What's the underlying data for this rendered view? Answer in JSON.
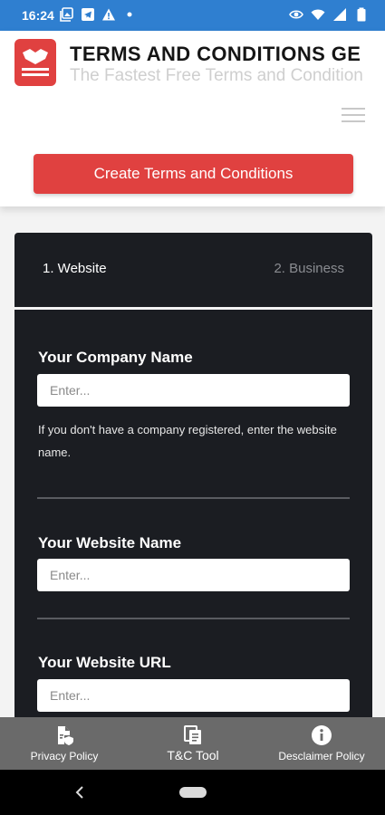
{
  "status_bar": {
    "time": "16:24",
    "left_icons": [
      "gallery-icon",
      "telegram-icon",
      "warning-icon",
      "dot-icon"
    ],
    "right_icons": [
      "eye-icon",
      "wifi-icon",
      "signal-icon",
      "battery-icon"
    ]
  },
  "header": {
    "title": "TERMS AND CONDITIONS GE",
    "subtitle": "The Fastest Free Terms and Condition",
    "cta_label": "Create Terms and Conditions",
    "accent_color": "#e04140"
  },
  "steps": {
    "active": "1. Website",
    "inactive": "2. Business"
  },
  "form": {
    "company": {
      "label": "Your Company Name",
      "placeholder": "Enter...",
      "value": "",
      "help": "If you don't have a company registered, enter the website name."
    },
    "website_name": {
      "label": "Your Website Name",
      "placeholder": "Enter...",
      "value": ""
    },
    "website_url": {
      "label": "Your Website URL",
      "placeholder": "Enter...",
      "value": ""
    }
  },
  "bottom_nav": {
    "items": [
      {
        "label": "Privacy Policy",
        "icon": "document-shield-icon"
      },
      {
        "label": "T&C Tool",
        "icon": "copy-document-icon"
      },
      {
        "label": "Desclaimer Policy",
        "icon": "info-icon"
      }
    ]
  }
}
